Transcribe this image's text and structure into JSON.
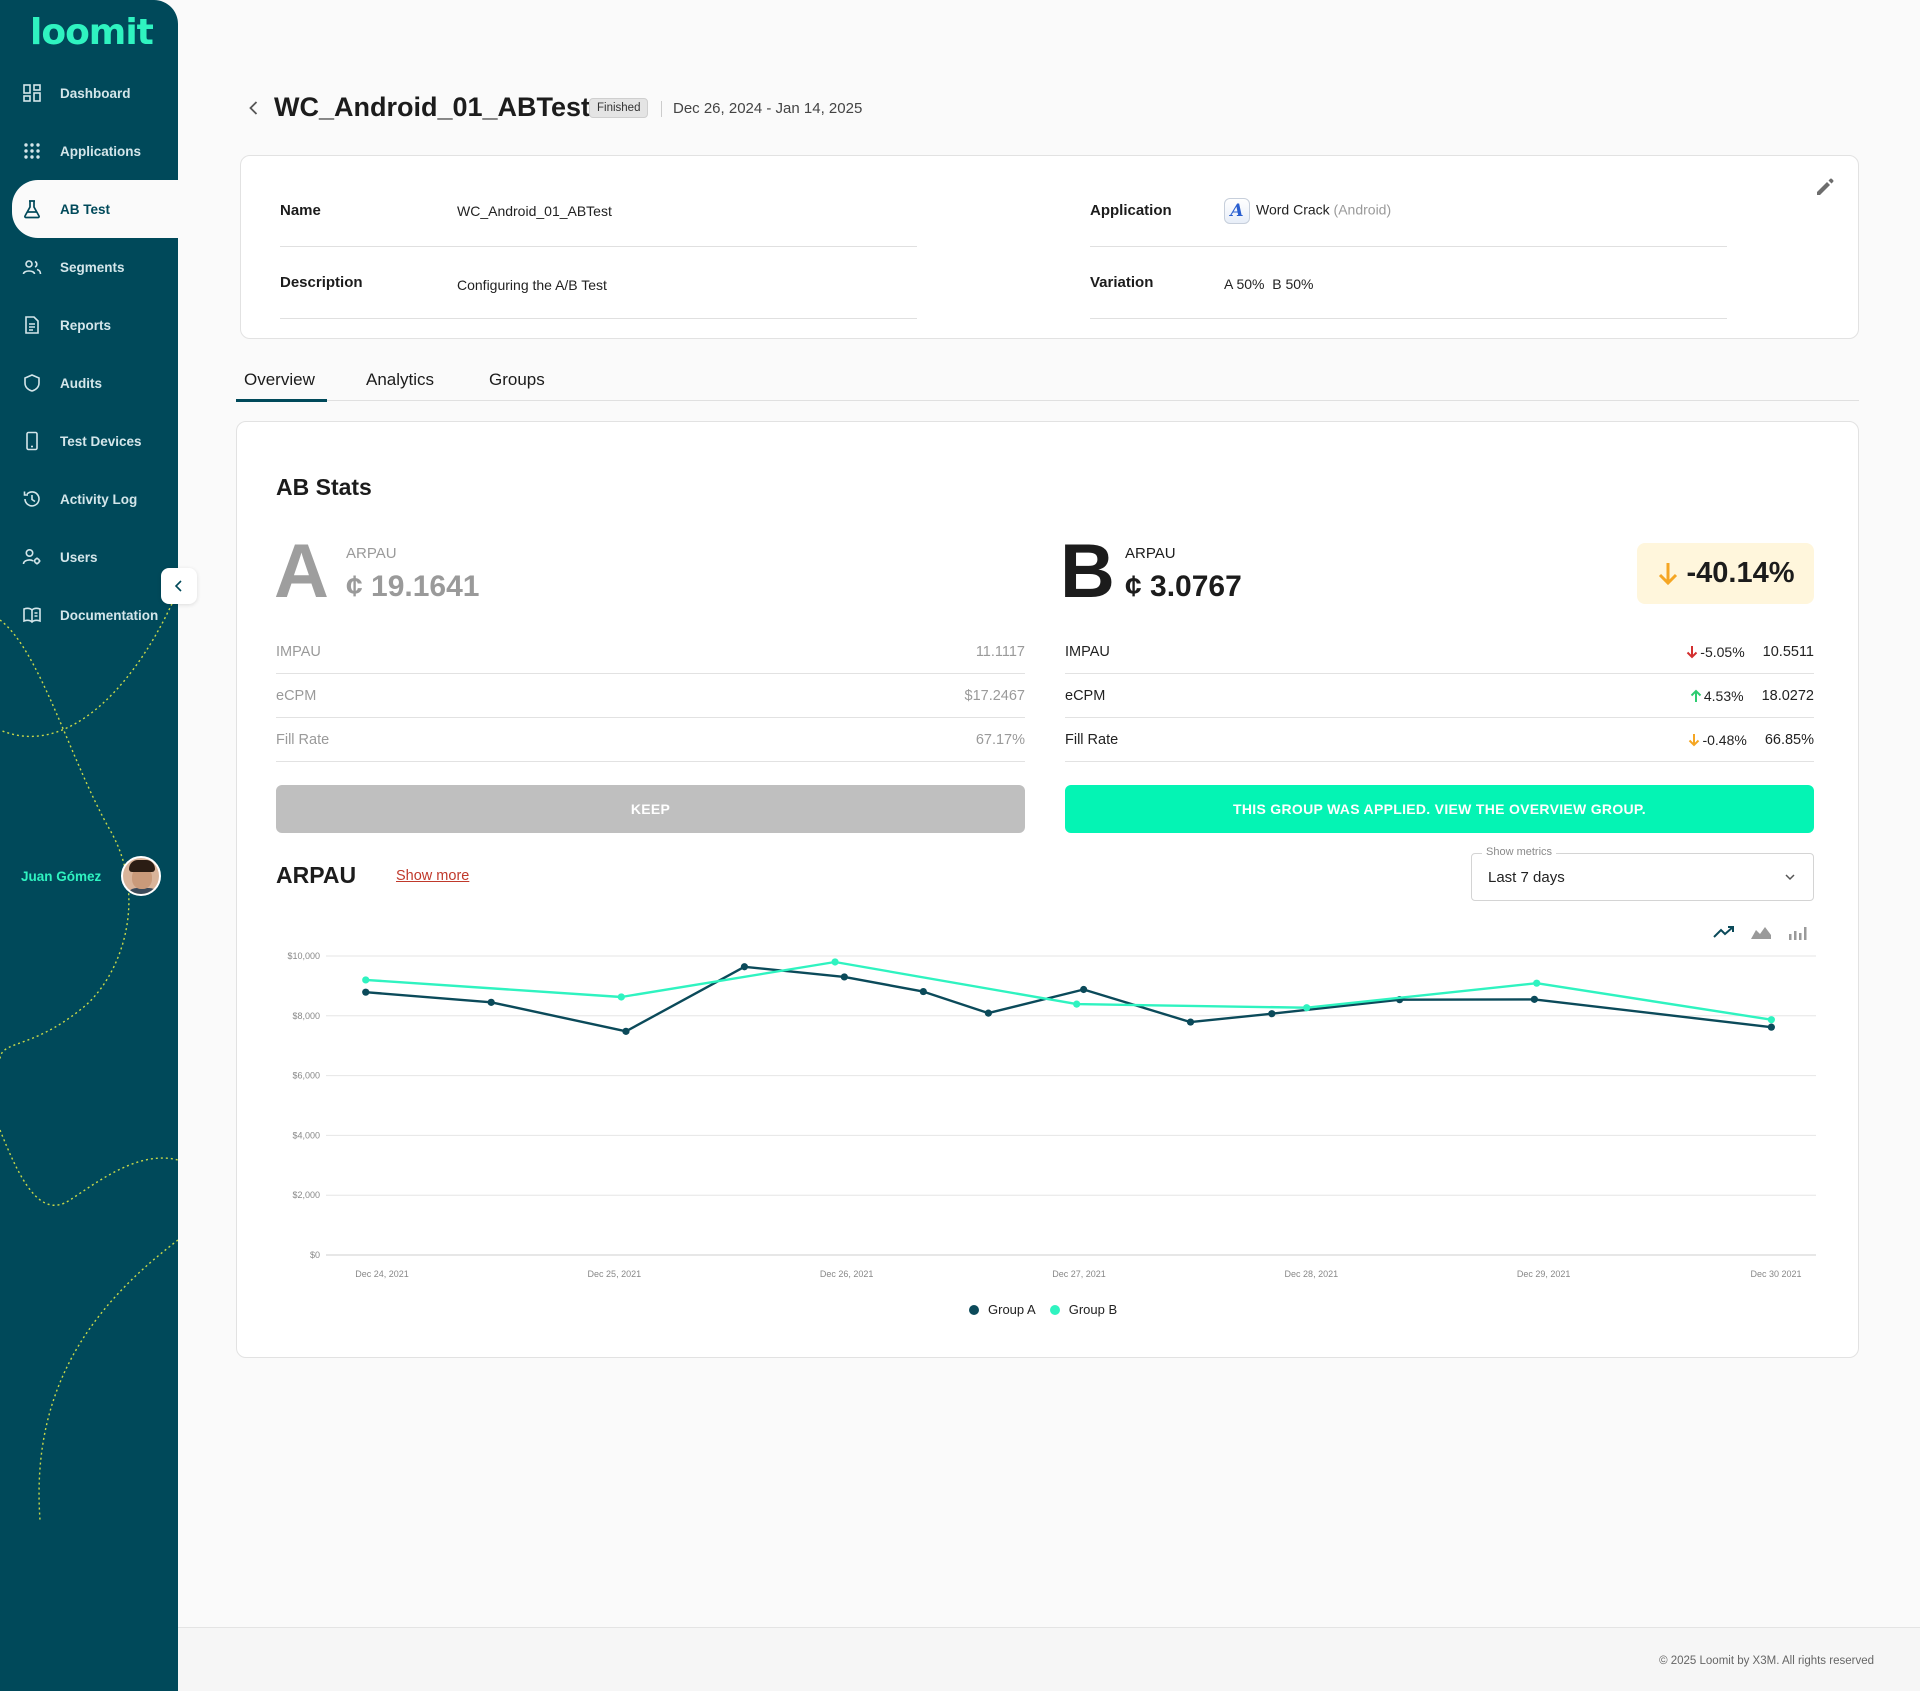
{
  "brand": {
    "logo_text": "loomit",
    "accent": "#2ff3c0",
    "sidebar_bg": "#00495a"
  },
  "sidebar": {
    "items": [
      {
        "label": "Dashboard",
        "icon": "dashboard-icon"
      },
      {
        "label": "Applications",
        "icon": "grid-icon"
      },
      {
        "label": "AB Test",
        "icon": "flask-icon",
        "active": true
      },
      {
        "label": "Segments",
        "icon": "users-group-icon"
      },
      {
        "label": "Reports",
        "icon": "document-icon"
      },
      {
        "label": "Audits",
        "icon": "shield-icon"
      },
      {
        "label": "Test Devices",
        "icon": "phone-icon"
      },
      {
        "label": "Activity Log",
        "icon": "history-icon"
      },
      {
        "label": "Users",
        "icon": "user-settings-icon"
      },
      {
        "label": "Documentation",
        "icon": "book-icon"
      }
    ],
    "user_name": "Juan Gómez"
  },
  "header": {
    "title": "WC_Android_01_ABTest",
    "status": "Finished",
    "date_range": "Dec 26, 2024 - Jan 14, 2025"
  },
  "info": {
    "name_label": "Name",
    "name_value": "WC_Android_01_ABTest",
    "description_label": "Description",
    "description_value": "Configuring the A/B Test",
    "application_label": "Application",
    "application_name": "Word Crack",
    "application_platform": "(Android)",
    "variation_label": "Variation",
    "variation_value": "A 50%  B 50%"
  },
  "tabs": [
    "Overview",
    "Analytics",
    "Groups"
  ],
  "ab_stats": {
    "title": "AB Stats",
    "a": {
      "letter": "A",
      "arpau_label": "ARPAU",
      "arpau_value": "¢ 19.1641",
      "rows": [
        {
          "label": "IMPAU",
          "value": "11.1117"
        },
        {
          "label": "eCPM",
          "value": "$17.2467"
        },
        {
          "label": "Fill Rate",
          "value": "67.17%"
        }
      ],
      "button": "KEEP"
    },
    "b": {
      "letter": "B",
      "arpau_label": "ARPAU",
      "arpau_value": "¢ 3.0767",
      "delta": "-40.14%",
      "rows": [
        {
          "label": "IMPAU",
          "delta": "-5.05%",
          "direction": "down",
          "delta_color": "#d32f2f",
          "value": "10.5511"
        },
        {
          "label": "eCPM",
          "delta": "4.53%",
          "direction": "up",
          "delta_color": "#2ecc71",
          "value": "18.0272"
        },
        {
          "label": "Fill Rate",
          "delta": "-0.48%",
          "direction": "down",
          "delta_color": "#f5a623",
          "value": "66.85%"
        }
      ],
      "button": "THIS GROUP WAS APPLIED. VIEW THE OVERVIEW GROUP."
    }
  },
  "arpau_section": {
    "title": "ARPAU",
    "show_more": "Show more",
    "select_label": "Show metrics",
    "select_value": "Last 7 days"
  },
  "chart_data": {
    "type": "line",
    "y_ticks": [
      "$0",
      "$2,000",
      "$4,000",
      "$6,000",
      "$8,000",
      "$10,000"
    ],
    "x_ticks": [
      "Dec 24, 2021",
      "Dec 25, 2021",
      "Dec 26, 2021",
      "Dec 27, 2021",
      "Dec 28, 2021",
      "Dec 29, 2021",
      "Dec 30 2021"
    ],
    "ylim": [
      0,
      10000
    ],
    "xlim": [
      0,
      6
    ],
    "grid": true,
    "legend": "bottom-center",
    "series": [
      {
        "name": "Group A",
        "color": "#0b4a5a",
        "points": [
          [
            -0.07,
            8790
          ],
          [
            0.47,
            8450
          ],
          [
            1.05,
            7480
          ],
          [
            1.56,
            9640
          ],
          [
            1.99,
            9300
          ],
          [
            2.33,
            8810
          ],
          [
            2.61,
            8090
          ],
          [
            3.02,
            8880
          ],
          [
            3.48,
            7790
          ],
          [
            3.83,
            8070
          ],
          [
            4.38,
            8540
          ],
          [
            4.96,
            8550
          ],
          [
            5.98,
            7620
          ]
        ]
      },
      {
        "name": "Group B",
        "color": "#2ff3c0",
        "points": [
          [
            -0.07,
            9200
          ],
          [
            1.03,
            8630
          ],
          [
            1.95,
            9800
          ],
          [
            2.99,
            8390
          ],
          [
            3.98,
            8270
          ],
          [
            4.97,
            9090
          ],
          [
            5.98,
            7870
          ]
        ]
      }
    ]
  },
  "footer": {
    "text": "© 2025 Loomit by X3M. All rights reserved"
  }
}
